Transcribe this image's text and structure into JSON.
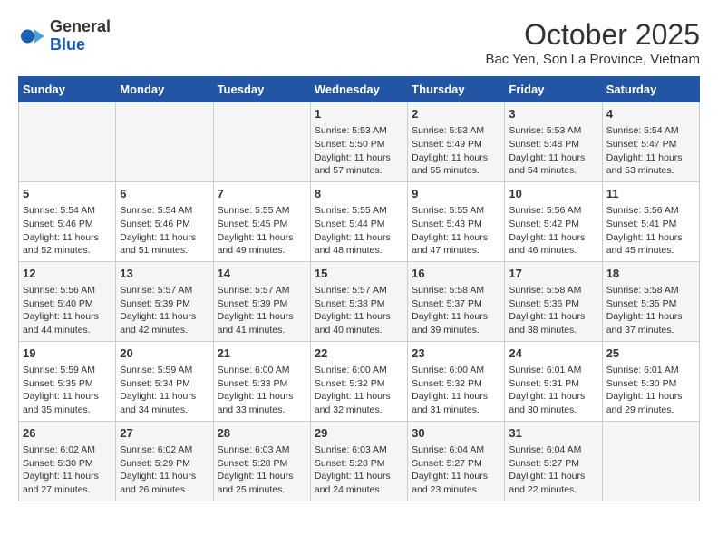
{
  "logo": {
    "general": "General",
    "blue": "Blue"
  },
  "header": {
    "month": "October 2025",
    "location": "Bac Yen, Son La Province, Vietnam"
  },
  "weekdays": [
    "Sunday",
    "Monday",
    "Tuesday",
    "Wednesday",
    "Thursday",
    "Friday",
    "Saturday"
  ],
  "weeks": [
    [
      {
        "day": "",
        "info": ""
      },
      {
        "day": "",
        "info": ""
      },
      {
        "day": "",
        "info": ""
      },
      {
        "day": "1",
        "info": "Sunrise: 5:53 AM\nSunset: 5:50 PM\nDaylight: 11 hours\nand 57 minutes."
      },
      {
        "day": "2",
        "info": "Sunrise: 5:53 AM\nSunset: 5:49 PM\nDaylight: 11 hours\nand 55 minutes."
      },
      {
        "day": "3",
        "info": "Sunrise: 5:53 AM\nSunset: 5:48 PM\nDaylight: 11 hours\nand 54 minutes."
      },
      {
        "day": "4",
        "info": "Sunrise: 5:54 AM\nSunset: 5:47 PM\nDaylight: 11 hours\nand 53 minutes."
      }
    ],
    [
      {
        "day": "5",
        "info": "Sunrise: 5:54 AM\nSunset: 5:46 PM\nDaylight: 11 hours\nand 52 minutes."
      },
      {
        "day": "6",
        "info": "Sunrise: 5:54 AM\nSunset: 5:46 PM\nDaylight: 11 hours\nand 51 minutes."
      },
      {
        "day": "7",
        "info": "Sunrise: 5:55 AM\nSunset: 5:45 PM\nDaylight: 11 hours\nand 49 minutes."
      },
      {
        "day": "8",
        "info": "Sunrise: 5:55 AM\nSunset: 5:44 PM\nDaylight: 11 hours\nand 48 minutes."
      },
      {
        "day": "9",
        "info": "Sunrise: 5:55 AM\nSunset: 5:43 PM\nDaylight: 11 hours\nand 47 minutes."
      },
      {
        "day": "10",
        "info": "Sunrise: 5:56 AM\nSunset: 5:42 PM\nDaylight: 11 hours\nand 46 minutes."
      },
      {
        "day": "11",
        "info": "Sunrise: 5:56 AM\nSunset: 5:41 PM\nDaylight: 11 hours\nand 45 minutes."
      }
    ],
    [
      {
        "day": "12",
        "info": "Sunrise: 5:56 AM\nSunset: 5:40 PM\nDaylight: 11 hours\nand 44 minutes."
      },
      {
        "day": "13",
        "info": "Sunrise: 5:57 AM\nSunset: 5:39 PM\nDaylight: 11 hours\nand 42 minutes."
      },
      {
        "day": "14",
        "info": "Sunrise: 5:57 AM\nSunset: 5:39 PM\nDaylight: 11 hours\nand 41 minutes."
      },
      {
        "day": "15",
        "info": "Sunrise: 5:57 AM\nSunset: 5:38 PM\nDaylight: 11 hours\nand 40 minutes."
      },
      {
        "day": "16",
        "info": "Sunrise: 5:58 AM\nSunset: 5:37 PM\nDaylight: 11 hours\nand 39 minutes."
      },
      {
        "day": "17",
        "info": "Sunrise: 5:58 AM\nSunset: 5:36 PM\nDaylight: 11 hours\nand 38 minutes."
      },
      {
        "day": "18",
        "info": "Sunrise: 5:58 AM\nSunset: 5:35 PM\nDaylight: 11 hours\nand 37 minutes."
      }
    ],
    [
      {
        "day": "19",
        "info": "Sunrise: 5:59 AM\nSunset: 5:35 PM\nDaylight: 11 hours\nand 35 minutes."
      },
      {
        "day": "20",
        "info": "Sunrise: 5:59 AM\nSunset: 5:34 PM\nDaylight: 11 hours\nand 34 minutes."
      },
      {
        "day": "21",
        "info": "Sunrise: 6:00 AM\nSunset: 5:33 PM\nDaylight: 11 hours\nand 33 minutes."
      },
      {
        "day": "22",
        "info": "Sunrise: 6:00 AM\nSunset: 5:32 PM\nDaylight: 11 hours\nand 32 minutes."
      },
      {
        "day": "23",
        "info": "Sunrise: 6:00 AM\nSunset: 5:32 PM\nDaylight: 11 hours\nand 31 minutes."
      },
      {
        "day": "24",
        "info": "Sunrise: 6:01 AM\nSunset: 5:31 PM\nDaylight: 11 hours\nand 30 minutes."
      },
      {
        "day": "25",
        "info": "Sunrise: 6:01 AM\nSunset: 5:30 PM\nDaylight: 11 hours\nand 29 minutes."
      }
    ],
    [
      {
        "day": "26",
        "info": "Sunrise: 6:02 AM\nSunset: 5:30 PM\nDaylight: 11 hours\nand 27 minutes."
      },
      {
        "day": "27",
        "info": "Sunrise: 6:02 AM\nSunset: 5:29 PM\nDaylight: 11 hours\nand 26 minutes."
      },
      {
        "day": "28",
        "info": "Sunrise: 6:03 AM\nSunset: 5:28 PM\nDaylight: 11 hours\nand 25 minutes."
      },
      {
        "day": "29",
        "info": "Sunrise: 6:03 AM\nSunset: 5:28 PM\nDaylight: 11 hours\nand 24 minutes."
      },
      {
        "day": "30",
        "info": "Sunrise: 6:04 AM\nSunset: 5:27 PM\nDaylight: 11 hours\nand 23 minutes."
      },
      {
        "day": "31",
        "info": "Sunrise: 6:04 AM\nSunset: 5:27 PM\nDaylight: 11 hours\nand 22 minutes."
      },
      {
        "day": "",
        "info": ""
      }
    ]
  ]
}
